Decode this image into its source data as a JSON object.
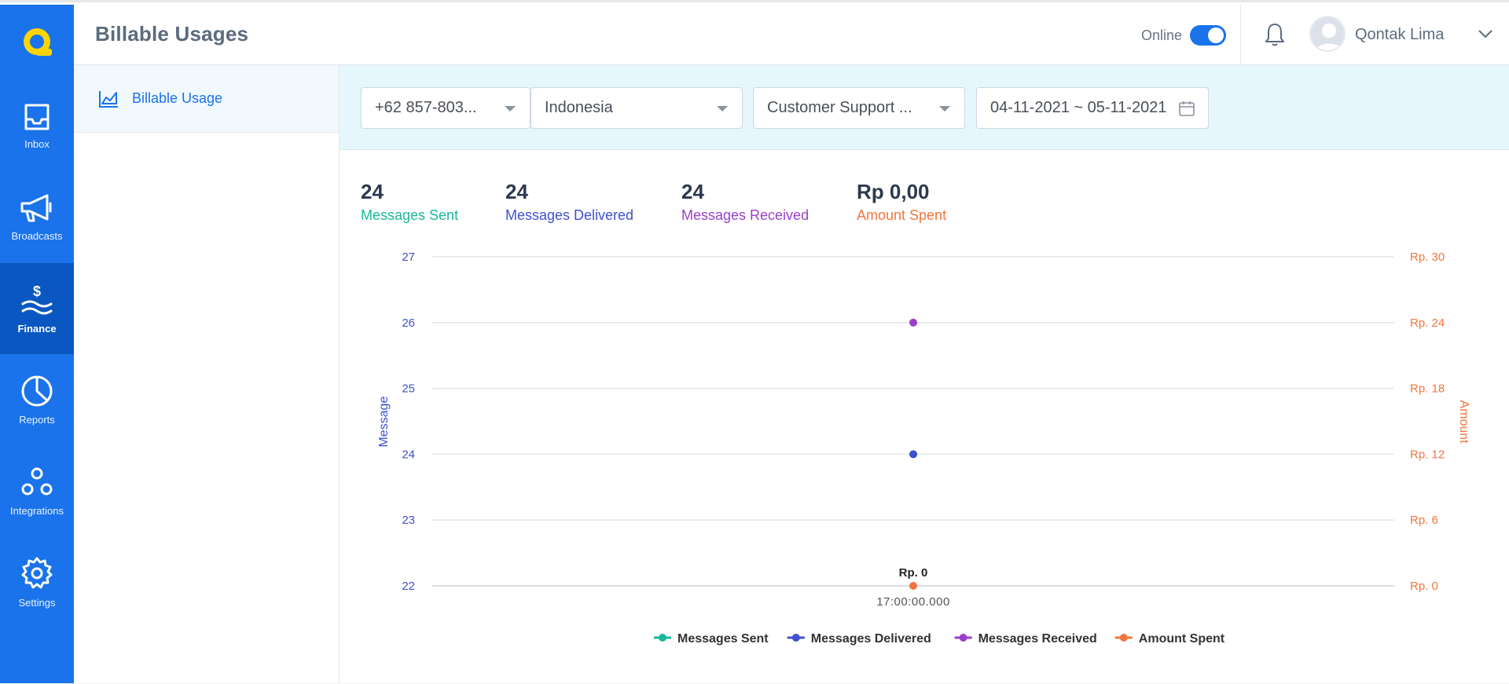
{
  "header": {
    "title": "Billable Usages",
    "online_label": "Online",
    "user_name": "Qontak Lima"
  },
  "sidebar": {
    "items": [
      {
        "label": "Inbox",
        "icon": "inbox-icon"
      },
      {
        "label": "Broadcasts",
        "icon": "megaphone-icon"
      },
      {
        "label": "Finance",
        "icon": "finance-icon",
        "active": true
      },
      {
        "label": "Reports",
        "icon": "pie-chart-icon"
      },
      {
        "label": "Integrations",
        "icon": "integrations-icon"
      },
      {
        "label": "Settings",
        "icon": "gear-icon"
      }
    ]
  },
  "subnav": {
    "items": [
      {
        "label": "Billable Usage",
        "icon": "area-chart-icon"
      }
    ]
  },
  "filters": {
    "phone": "+62 857-803...",
    "country": "Indonesia",
    "channel": "Customer Support ...",
    "date_range": "04-11-2021 ~ 05-11-2021"
  },
  "stats": {
    "sent": {
      "value": "24",
      "label": "Messages Sent"
    },
    "delivered": {
      "value": "24",
      "label": "Messages Delivered"
    },
    "received": {
      "value": "24",
      "label": "Messages Received"
    },
    "amount": {
      "value": "Rp 0,00",
      "label": "Amount Spent"
    }
  },
  "colors": {
    "primary": "#1a73ea",
    "sent": "#18b89a",
    "delivered": "#3f51d0",
    "received": "#9b3fc9",
    "amount": "#f2763d",
    "grid": "#e3e6ea"
  },
  "chart_data": {
    "type": "scatter",
    "x_categories": [
      "17:00:00.000"
    ],
    "ylabel_left": "Message",
    "ylabel_right": "Amount",
    "ylim_left": [
      22,
      27
    ],
    "yticks_left": [
      22,
      23,
      24,
      25,
      26,
      27
    ],
    "ylim_right": [
      0,
      30
    ],
    "yticks_right": [
      "Rp. 0",
      "Rp. 6",
      "Rp. 12",
      "Rp. 18",
      "Rp. 24",
      "Rp. 30"
    ],
    "grid": true,
    "legend_position": "bottom-center",
    "series": [
      {
        "name": "Messages Sent",
        "axis": "left",
        "values": [
          24
        ],
        "color": "#18b89a"
      },
      {
        "name": "Messages Delivered",
        "axis": "left",
        "values": [
          24
        ],
        "color": "#3f51d0"
      },
      {
        "name": "Messages Received",
        "axis": "left",
        "values": [
          26
        ],
        "color": "#9b3fc9"
      },
      {
        "name": "Amount Spent",
        "axis": "right",
        "values": [
          0
        ],
        "color": "#f2763d",
        "data_label": "Rp. 0"
      }
    ]
  }
}
